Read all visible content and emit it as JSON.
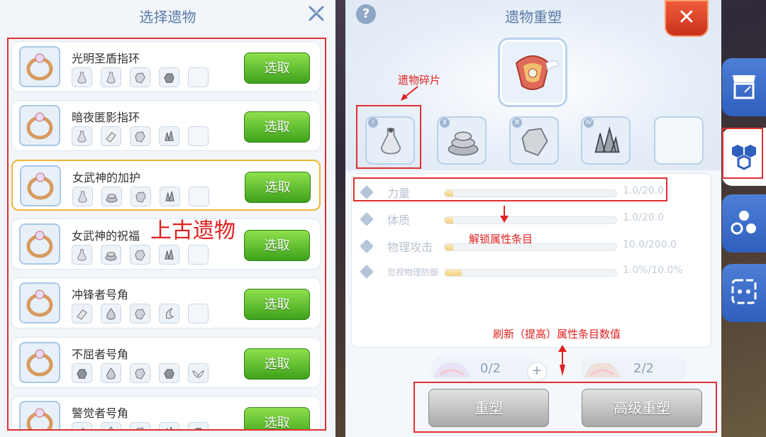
{
  "left_panel": {
    "title": "选择遗物",
    "pick_label": "选取",
    "items": [
      {
        "name": "光明圣盾指环",
        "fragments": [
          "bottle",
          "bottle",
          "stone",
          "rock",
          "empty"
        ]
      },
      {
        "name": "暗夜匿影指环",
        "fragments": [
          "bottle",
          "chips",
          "stone",
          "crystal",
          "empty"
        ]
      },
      {
        "name": "女武神的加护",
        "fragments": [
          "bottle",
          "pile",
          "stone",
          "crystal",
          "empty"
        ],
        "selected": true
      },
      {
        "name": "女武神的祝福",
        "fragments": [
          "bottle",
          "pile",
          "stone",
          "crystal",
          "empty"
        ]
      },
      {
        "name": "冲锋者号角",
        "fragments": [
          "chips",
          "drop",
          "stone",
          "moon",
          "empty"
        ]
      },
      {
        "name": "不屈者号角",
        "fragments": [
          "rock",
          "drop",
          "stone",
          "rock",
          "wing"
        ]
      },
      {
        "name": "警觉者号角",
        "fragments": [
          "chips",
          "drop",
          "stone",
          "crystal",
          "rock"
        ]
      }
    ],
    "annotation": "上古遗物"
  },
  "reforge_panel": {
    "title": "遗物重塑",
    "help_label": "?",
    "close_label": "✕",
    "slots": [
      {
        "numeral": "Ⅰ",
        "icon": "bottle"
      },
      {
        "numeral": "Ⅱ",
        "icon": "pile"
      },
      {
        "numeral": "Ⅲ",
        "icon": "stone"
      },
      {
        "numeral": "Ⅳ",
        "icon": "crystal"
      },
      {
        "numeral": "",
        "icon": "empty"
      }
    ],
    "fragment_annotation": "遗物碎片",
    "attributes": [
      {
        "name": "力量",
        "value": "1.0/20.0",
        "progress": 0.05
      },
      {
        "name": "体质",
        "value": "1.0/20.0",
        "progress": 0.05
      },
      {
        "name": "物理攻击",
        "value": "10.0/200.0",
        "progress": 0.05
      },
      {
        "name": "忽视物理防御",
        "value": "1.0%/10.0%",
        "progress": 0.1
      }
    ],
    "attribute_annotation": "解锁属性条目",
    "refresh_annotation": "刷新（提高）属性条目数值",
    "materials": [
      {
        "count": "0/2"
      },
      {
        "count": "2/2"
      }
    ],
    "plus_label": "+",
    "reforge_button": "重塑",
    "advanced_reforge_button": "高级重塑"
  },
  "colors": {
    "accent": "#5a7aa6",
    "pick_green": "#3da21b",
    "annotation_red": "#e02020"
  }
}
